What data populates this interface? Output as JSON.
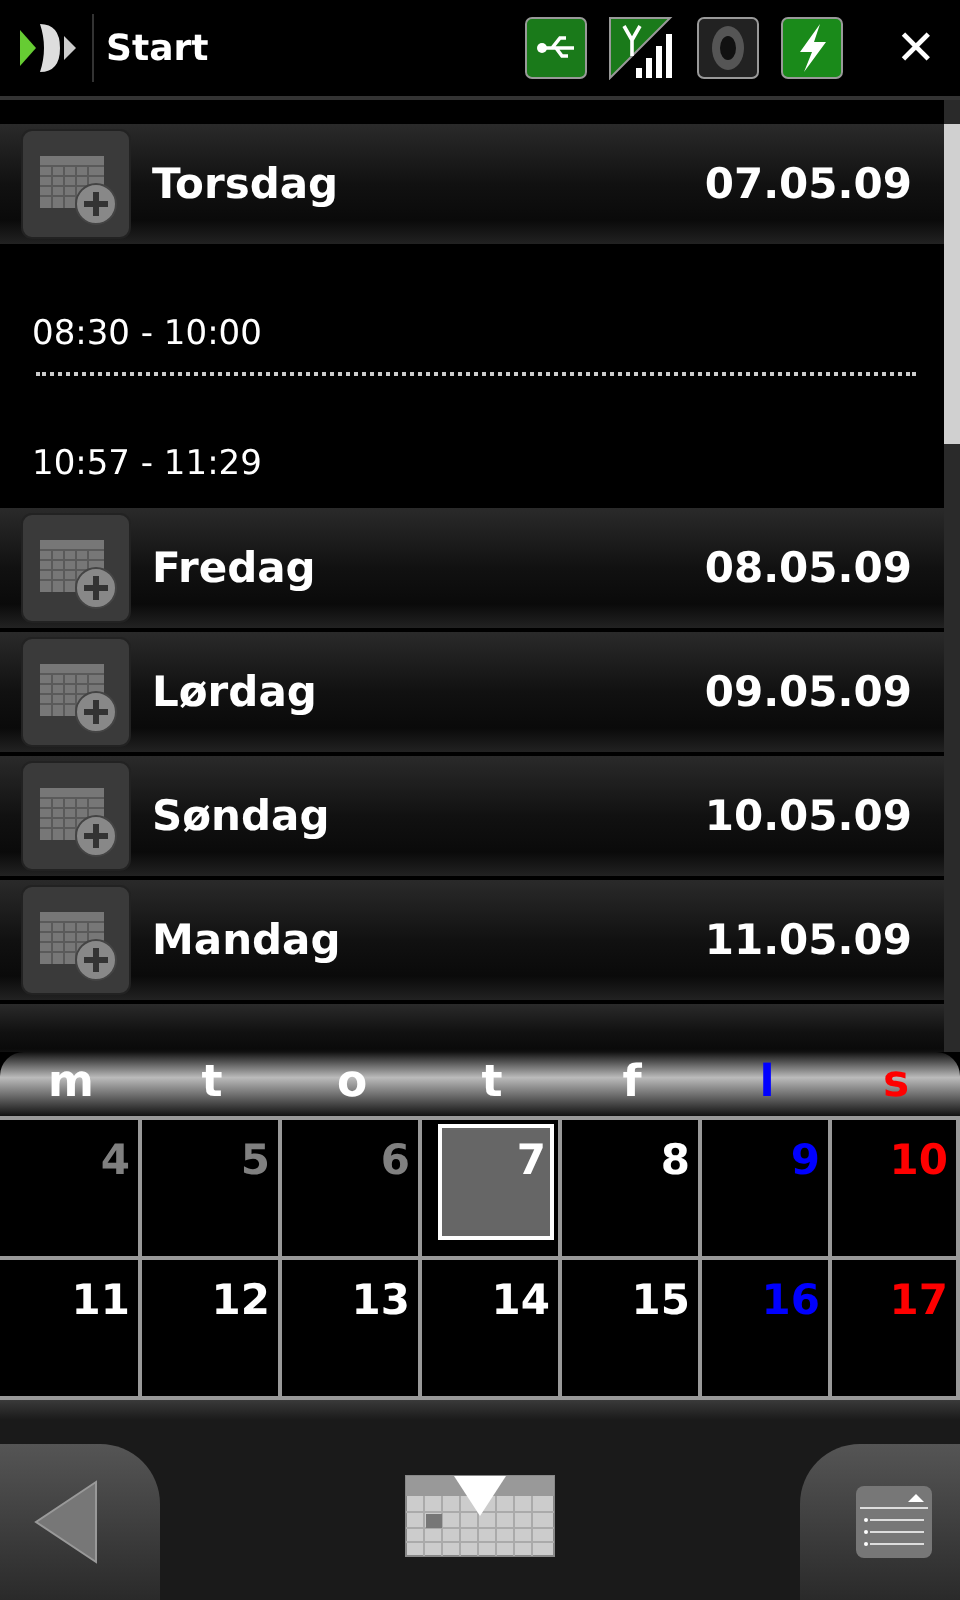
{
  "title_bar": {
    "title": "Start",
    "close": "✕"
  },
  "days": [
    {
      "day": "Torsdag",
      "date": "07.05.09",
      "events": [
        {
          "time": "08:30 - 10:00"
        },
        {
          "time": "10:57 - 11:29"
        }
      ]
    },
    {
      "day": "Fredag",
      "date": "08.05.09"
    },
    {
      "day": "Lørdag",
      "date": "09.05.09"
    },
    {
      "day": "Søndag",
      "date": "10.05.09"
    },
    {
      "day": "Mandag",
      "date": "11.05.09"
    }
  ],
  "calendar": {
    "weekdays": [
      {
        "label": "m",
        "kind": "weekday"
      },
      {
        "label": "t",
        "kind": "weekday"
      },
      {
        "label": "o",
        "kind": "weekday"
      },
      {
        "label": "t",
        "kind": "weekday"
      },
      {
        "label": "f",
        "kind": "weekday"
      },
      {
        "label": "l",
        "kind": "saturday"
      },
      {
        "label": "s",
        "kind": "sunday"
      }
    ],
    "weeks": [
      [
        {
          "day": "4",
          "color": "#808080",
          "selected": false
        },
        {
          "day": "5",
          "color": "#808080",
          "selected": false
        },
        {
          "day": "6",
          "color": "#808080",
          "selected": false
        },
        {
          "day": "7",
          "color": "#ffffff",
          "selected": true
        },
        {
          "day": "8",
          "color": "#ffffff",
          "selected": false
        },
        {
          "day": "9",
          "color": "#0000ff",
          "selected": false
        },
        {
          "day": "10",
          "color": "#ff0000",
          "selected": false
        }
      ],
      [
        {
          "day": "11",
          "color": "#ffffff",
          "selected": false
        },
        {
          "day": "12",
          "color": "#ffffff",
          "selected": false
        },
        {
          "day": "13",
          "color": "#ffffff",
          "selected": false
        },
        {
          "day": "14",
          "color": "#ffffff",
          "selected": false
        },
        {
          "day": "15",
          "color": "#ffffff",
          "selected": false
        },
        {
          "day": "16",
          "color": "#0000ff",
          "selected": false
        },
        {
          "day": "17",
          "color": "#ff0000",
          "selected": false
        }
      ]
    ]
  }
}
